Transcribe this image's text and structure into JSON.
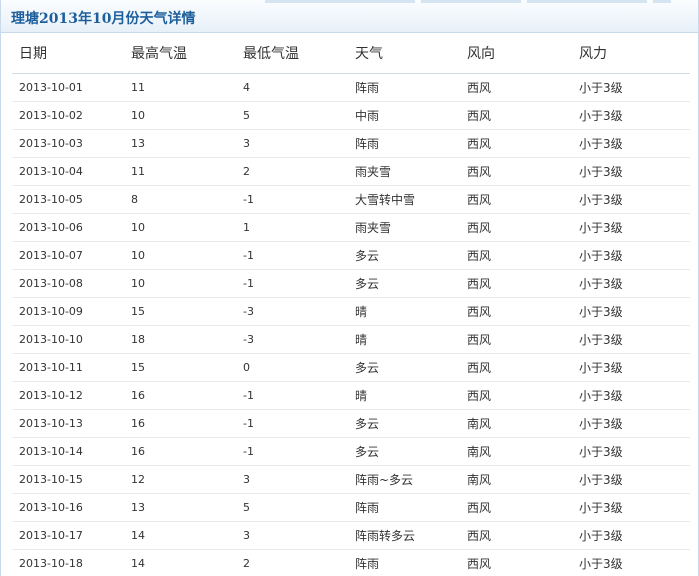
{
  "panel": {
    "title": "理塘2013年10月份天气详情"
  },
  "table": {
    "headers": [
      "日期",
      "最高气温",
      "最低气温",
      "天气",
      "风向",
      "风力"
    ],
    "rows": [
      [
        "2013-10-01",
        "11",
        "4",
        "阵雨",
        "西风",
        "小于3级"
      ],
      [
        "2013-10-02",
        "10",
        "5",
        "中雨",
        "西风",
        "小于3级"
      ],
      [
        "2013-10-03",
        "13",
        "3",
        "阵雨",
        "西风",
        "小于3级"
      ],
      [
        "2013-10-04",
        "11",
        "2",
        "雨夹雪",
        "西风",
        "小于3级"
      ],
      [
        "2013-10-05",
        "8",
        "-1",
        "大雪转中雪",
        "西风",
        "小于3级"
      ],
      [
        "2013-10-06",
        "10",
        "1",
        "雨夹雪",
        "西风",
        "小于3级"
      ],
      [
        "2013-10-07",
        "10",
        "-1",
        "多云",
        "西风",
        "小于3级"
      ],
      [
        "2013-10-08",
        "10",
        "-1",
        "多云",
        "西风",
        "小于3级"
      ],
      [
        "2013-10-09",
        "15",
        "-3",
        "晴",
        "西风",
        "小于3级"
      ],
      [
        "2013-10-10",
        "18",
        "-3",
        "晴",
        "西风",
        "小于3级"
      ],
      [
        "2013-10-11",
        "15",
        "0",
        "多云",
        "西风",
        "小于3级"
      ],
      [
        "2013-10-12",
        "16",
        "-1",
        "晴",
        "西风",
        "小于3级"
      ],
      [
        "2013-10-13",
        "16",
        "-1",
        "多云",
        "南风",
        "小于3级"
      ],
      [
        "2013-10-14",
        "16",
        "-1",
        "多云",
        "南风",
        "小于3级"
      ],
      [
        "2013-10-15",
        "12",
        "3",
        "阵雨~多云",
        "南风",
        "小于3级"
      ],
      [
        "2013-10-16",
        "13",
        "5",
        "阵雨",
        "西风",
        "小于3级"
      ],
      [
        "2013-10-17",
        "14",
        "3",
        "阵雨转多云",
        "西风",
        "小于3级"
      ],
      [
        "2013-10-18",
        "14",
        "2",
        "阵雨",
        "西风",
        "小于3级"
      ]
    ]
  }
}
